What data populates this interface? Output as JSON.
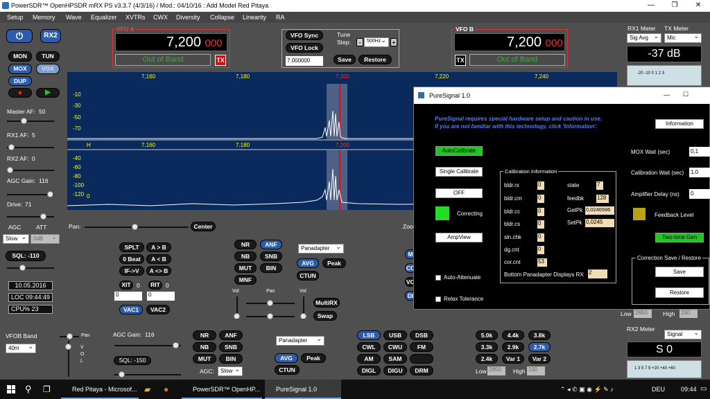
{
  "window": {
    "title": "PowerSDR™ OpenHPSDR mRX PS v3.3.7 (4/3/16) / Mod.: 04/10/16 : Add Model Red Pitaya",
    "minimize": "—",
    "maximize": "❐",
    "close": "✕"
  },
  "menu": [
    "Setup",
    "Memory",
    "Wave",
    "Equalizer",
    "XVTRs",
    "CWX",
    "Diversity",
    "Collapse",
    "Linearity",
    "RA"
  ],
  "left": {
    "power_icon": "power-icon",
    "rx2": "RX2",
    "mon": "MON",
    "tun": "TUN",
    "mox": "MOX",
    "vox": "VOX",
    "dup": "DUP",
    "master_af": "Master AF:",
    "master_af_val": "50",
    "rx1_af": "RX1 AF:",
    "rx1_af_val": "5",
    "rx2_af": "RX2 AF:",
    "rx2_af_val": "0",
    "agc_gain": "AGC Gain:",
    "agc_gain_val": "116",
    "drive": "Drive:",
    "drive_val": "71",
    "agc": "AGC",
    "att": "ATT",
    "agc_mode": "Slow",
    "att_val": "0dB",
    "sql": "SQL:",
    "sql_val": "-110",
    "date": "10.05.2016",
    "loc": "LOC 09:44:49",
    "cpu": "CPU% 23",
    "vfob_band": "VFOB Band",
    "band_val": "40m"
  },
  "vfoa": {
    "label": "VFO A",
    "freq": "7,200",
    "freq_sub": "000",
    "status": "Out of Band",
    "tx": "TX"
  },
  "vfob": {
    "label": "VFO B",
    "freq": "7,200",
    "freq_sub": "000",
    "status": "Out of Band",
    "tx": "TX"
  },
  "center": {
    "vfo_sync": "VFO Sync",
    "vfo_lock": "VFO Lock",
    "freq_field": "7.000000",
    "tune_step": "Tune",
    "step": "Step:",
    "step_val": "500Hz",
    "minus": "-",
    "plus": "+",
    "save": "Save",
    "restore": "Restore"
  },
  "meters": {
    "rx1_meter": "RX1 Meter",
    "tx_meter": "TX Meter",
    "rx1_mode": "Sig Avg",
    "tx_mode": "Mic",
    "level": "-37 dB",
    "scale": "-20  -10    0  1 2 3",
    "rx2_meter": "RX2 Meter",
    "rx2_mode": "Signal",
    "rx2_level": "S 0",
    "rx2_scale": "1  3  5  7  9  +20 +40 +60"
  },
  "spectrum": {
    "top_ticks": [
      "7,160",
      "7,180",
      "7,200",
      "7,220",
      "7,240"
    ],
    "mid_ticks": [
      "7,160",
      "7,180",
      "7,200"
    ],
    "top_db": [
      "-10",
      "-30",
      "-50",
      "-70"
    ],
    "bot_db": [
      "-40",
      "-60",
      "-80",
      "-100",
      "-120"
    ],
    "marker_h": "H",
    "marker_0": "0"
  },
  "pan": "Pan:",
  "center_btn": "Center",
  "zoom": "Zoo",
  "rx1_ctrl": {
    "splt": "SPLT",
    "ab": "A > B",
    "zero_beat": "0 Beat",
    "ba": "A < B",
    "iftov": "IF->V",
    "aswap": "A <> B",
    "xit": "XIT",
    "xit_v": "0",
    "rit": "RIT",
    "rit_v": "0",
    "xit_num": "0",
    "rit_num": "0",
    "vac1": "VAC1",
    "vac2": "VAC2",
    "nr": "NR",
    "anf": "ANF",
    "nb": "NB",
    "snb": "SNB",
    "mut": "MUT",
    "bin": "BIN",
    "mnf": "MNF",
    "panadapter": "Panadapter",
    "avg": "AVG",
    "peak": "Peak",
    "ctun": "CTUN",
    "vol": "Vol",
    "pan": "Pan",
    "vol2": "Vol",
    "multirx": "MultiRX",
    "swap": "Swap"
  },
  "rx2_ctrl": {
    "pan": "Pan",
    "vol_letters": [
      "V",
      "O",
      "L"
    ],
    "agc_gain": "AGC Gain:",
    "agc_gain_val": "116",
    "sql": "SQL:",
    "sql_val": "-150",
    "nr": "NR",
    "anf": "ANF",
    "nb": "NB",
    "snb": "SNB",
    "mut": "MUT",
    "bin": "BIN",
    "agc": "AGC:",
    "agc_mode": "Slow",
    "panadapter": "Panadapter",
    "avg": "AVG",
    "peak": "Peak",
    "ctun": "CTUN",
    "modes": [
      "LSB",
      "USB",
      "DSB",
      "CWL",
      "CWU",
      "FM",
      "AM",
      "SAM",
      "",
      "DIGL",
      "DIGU",
      "DRM"
    ],
    "filters": [
      "5.0k",
      "4.4k",
      "3.8k",
      "3.3k",
      "2.9k",
      "2.7k",
      "2.4k",
      "Var 1",
      "Var 2"
    ],
    "low": "Low",
    "low_val": "2850",
    "high": "High",
    "high_val": "150"
  },
  "rx1_filter": {
    "low": "Low",
    "low_val": "2850",
    "high": "High",
    "high_val": "150"
  },
  "partial_buttons": [
    "M",
    "CC",
    "VO",
    "DI"
  ],
  "puresignal": {
    "title": "PureSignal 1.0",
    "warning1": "PureSignal requires special hardware setup and caution in use.",
    "warning2": "If you are not familiar with this technology, click 'Information'.",
    "information": "Information",
    "autocal": "AutoCalibrate",
    "single": "Single Calibrate",
    "off": "OFF",
    "correcting": "Correcting",
    "ampview": "AmpView",
    "auto_att": "Auto-Attenuate",
    "relax": "Relax Tolerance",
    "cal_info": "Calibration Information",
    "left_fields": [
      {
        "k": "bldr.rx",
        "v": "0"
      },
      {
        "k": "bldr.cm",
        "v": "0"
      },
      {
        "k": "bldr.cc",
        "v": "0"
      },
      {
        "k": "bldr.cs",
        "v": "0"
      },
      {
        "k": "sln.chk",
        "v": "0"
      },
      {
        "k": "dg.cnt",
        "v": "0"
      },
      {
        "k": "cor.cnt",
        "v": "53"
      }
    ],
    "right_fields": [
      {
        "k": "state",
        "v": "7"
      },
      {
        "k": "feedbk",
        "v": "128"
      },
      {
        "k": "GetPk",
        "v": "0,0246596"
      },
      {
        "k": "SetPk",
        "v": "0,0245"
      }
    ],
    "bottom_pan": "Bottom Panadapter Displays RX",
    "bottom_pan_val": "2",
    "mox_wait": "MOX Wait (sec)",
    "mox_wait_val": "0,1",
    "cal_wait": "Calibration Wait (sec)",
    "cal_wait_val": "1,0",
    "amp_delay": "Amplifier Delay (ns)",
    "amp_delay_val": "0",
    "feedback": "Feedback Level",
    "twotone": "Two-tone Gen",
    "corr_group": "Correction Save / Restore",
    "save": "Save",
    "restore": "Restore",
    "min": "—",
    "max": "☐"
  },
  "taskbar": {
    "search_icon": "search-icon",
    "items": [
      "Red Pitaya - Microsof...",
      "PowerSDR™ OpenHP...",
      "PureSignal 1.0"
    ],
    "lang": "DEU",
    "time": "09:44"
  },
  "colors": {
    "spectrum_bg": "#0a2a5e",
    "green_btn": "#22c422",
    "accent_blue": "#2d5ca8"
  }
}
